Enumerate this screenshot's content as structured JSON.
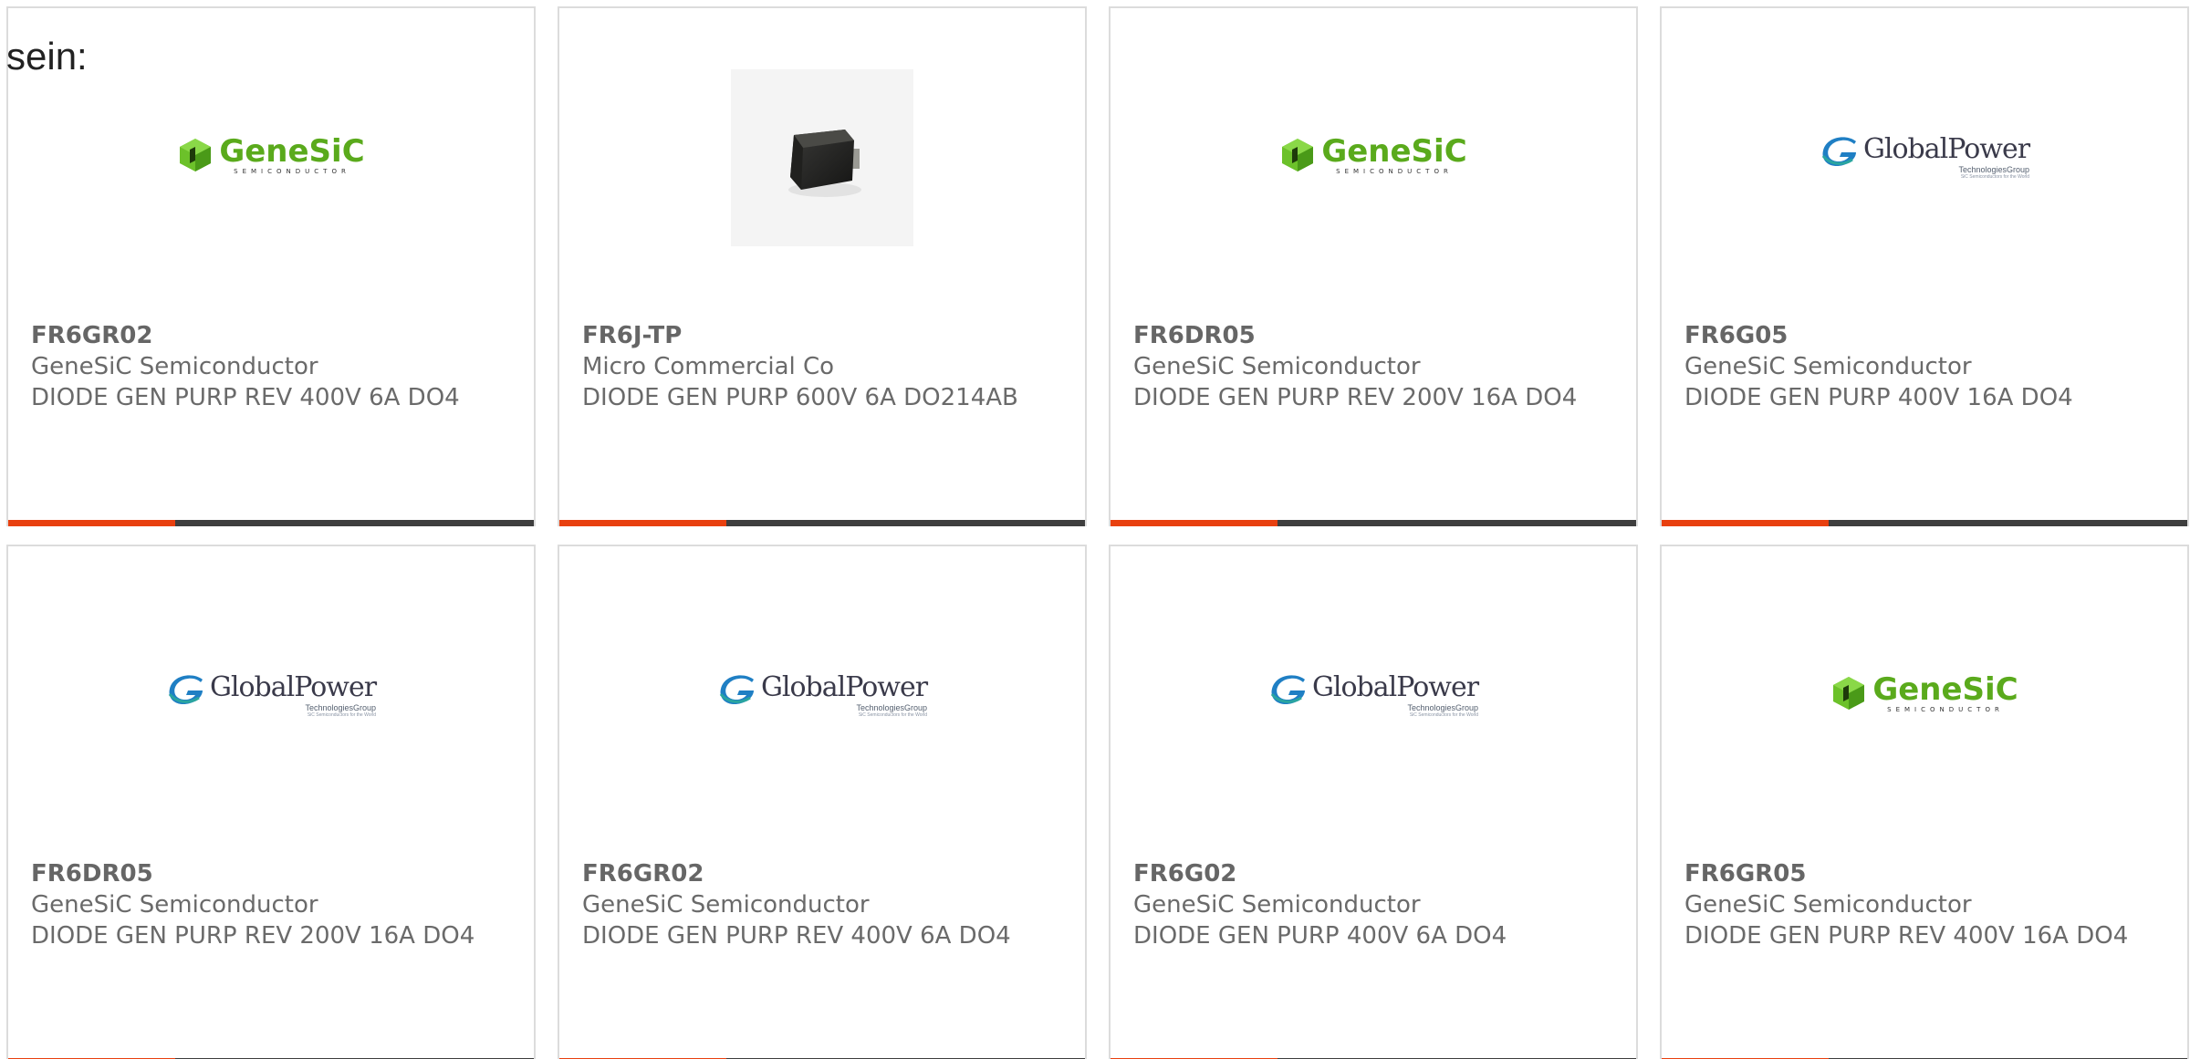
{
  "heading": "sein:",
  "cards": [
    {
      "part_number": "FR6GR02",
      "manufacturer": "GeneSiC Semiconductor",
      "description": "DIODE GEN PURP REV 400V 6A DO4",
      "image": "genesic-logo"
    },
    {
      "part_number": "FR6J-TP",
      "manufacturer": "Micro Commercial Co",
      "description": "DIODE GEN PURP 600V 6A DO214AB",
      "image": "diode-package-photo"
    },
    {
      "part_number": "FR6DR05",
      "manufacturer": "GeneSiC Semiconductor",
      "description": "DIODE GEN PURP REV 200V 16A DO4",
      "image": "genesic-logo"
    },
    {
      "part_number": "FR6G05",
      "manufacturer": "GeneSiC Semiconductor",
      "description": "DIODE GEN PURP 400V 16A DO4",
      "image": "globalpower-logo"
    },
    {
      "part_number": "FR6DR05",
      "manufacturer": "GeneSiC Semiconductor",
      "description": "DIODE GEN PURP REV 200V 16A DO4",
      "image": "globalpower-logo"
    },
    {
      "part_number": "FR6GR02",
      "manufacturer": "GeneSiC Semiconductor",
      "description": "DIODE GEN PURP REV 400V 6A DO4",
      "image": "globalpower-logo"
    },
    {
      "part_number": "FR6G02",
      "manufacturer": "GeneSiC Semiconductor",
      "description": "DIODE GEN PURP 400V 6A DO4",
      "image": "globalpower-logo"
    },
    {
      "part_number": "FR6GR05",
      "manufacturer": "GeneSiC Semiconductor",
      "description": "DIODE GEN PURP REV 400V 16A DO4",
      "image": "genesic-logo"
    }
  ],
  "logos": {
    "genesic": {
      "name": "GeneSiC",
      "sub": "SEMICONDUCTOR"
    },
    "globalpower": {
      "name": "GlobalPower",
      "sub": "TechnologiesGroup",
      "tag": "SiC Semiconductors for the World"
    }
  },
  "colors": {
    "accent": "#e8400f",
    "bar": "#3e3e3e",
    "text": "#6a6a6a",
    "border": "#dcdcdc",
    "genesic_green": "#5aaa1c",
    "globalpower_blue": "#1f7fc4"
  }
}
